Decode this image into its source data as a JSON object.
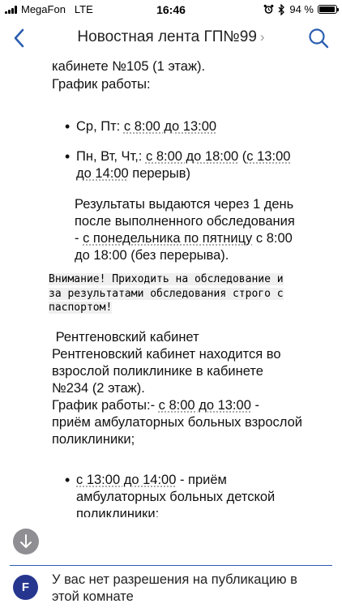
{
  "status_bar": {
    "carrier": "MegaFon",
    "network": "LTE",
    "time": "16:46",
    "battery_percent_label": "94 %",
    "battery_level": 94
  },
  "header": {
    "title": "Новостная лента ГП№99",
    "title_chevron": "›",
    "back_icon": "chevron-left-icon",
    "search_icon": "search-icon"
  },
  "article": {
    "line_top_1": "кабинете №105 (1 этаж).",
    "line_top_2": "График работы:",
    "bullet1_a": "Ср, Пт: ",
    "bullet1_b": "с 8:00 до 13:00",
    "bullet2_line1_a": "Пн, Вт, Чт,: ",
    "bullet2_line1_b": "с 8:00 до 18:00",
    "bullet2_line1_c": " (",
    "bullet2_line1_d": "с 13:00",
    "bullet2_line2_a": "до 14:00",
    "bullet2_line2_b": " перерыв)",
    "results_1": "Результаты выдаются через 1 день",
    "results_2": "после выполненного обследования",
    "results_3a": "- ",
    "results_3b": "с понедельника по пятницу",
    "results_3c": " с 8:00",
    "results_4": "до 18:00 (без перерыва).",
    "notice_1": "Внимание! Приходить на обследование и",
    "notice_2": "за результатами обследования строго с",
    "notice_3": "паспортом!",
    "xray_1": " Рентгеновский кабинет",
    "xray_2": "Рентгеновский кабинет находится во",
    "xray_3": "взрослой поликлинике в кабинете",
    "xray_4": "№234 (2 этаж).",
    "xray_5a": "График работы:- ",
    "xray_5b": "с 8:00 до 13:00",
    "xray_5c": " -",
    "xray_6": "приём амбулаторных больных взрослой",
    "xray_7": "поликлиники;",
    "bullet3_line1_a": "с 13:00 до 14:00",
    "bullet3_line1_b": " - приём",
    "bullet3_line2": "амбулаторных больных детской",
    "bullet3_line3": "поликлиники;"
  },
  "footer": {
    "scroll_icon": "arrow-down-icon",
    "avatar_letter": "F",
    "permission_line1": "У вас нет разрешения на публикацию в",
    "permission_line2": "этой комнате"
  },
  "colors": {
    "accent": "#2a5db0",
    "avatar_bg": "#26368f",
    "scroll_button_bg": "#8e8e93"
  }
}
